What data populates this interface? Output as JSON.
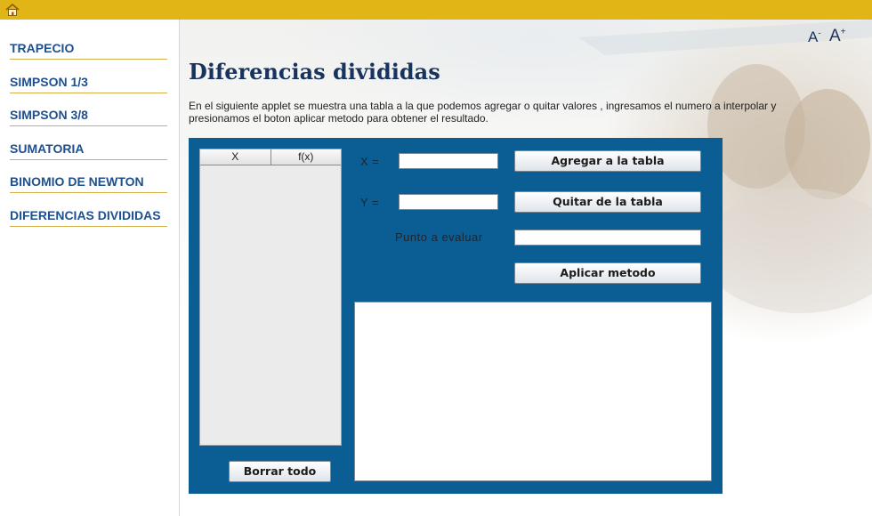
{
  "topbar": {
    "home_icon": "home-icon"
  },
  "sidebar": {
    "items": [
      {
        "label": "TRAPECIO"
      },
      {
        "label": "SIMPSON 1/3"
      },
      {
        "label": "SIMPSON 3/8"
      },
      {
        "label": "SUMATORIA"
      },
      {
        "label": "BINOMIO DE NEWTON"
      },
      {
        "label": "DIFERENCIAS DIVIDIDAS"
      }
    ]
  },
  "font_controls": {
    "decrease": "A",
    "decrease_sup": "-",
    "increase": "A",
    "increase_sup": "+"
  },
  "page": {
    "title": "Diferencias divididas",
    "description": "En el siguiente applet se muestra una tabla a la que podemos agregar o quitar valores , ingresamos el numero a interpolar y presionamos el boton aplicar metodo para obtener el resultado."
  },
  "applet": {
    "table": {
      "columns": [
        "X",
        "f(x)"
      ],
      "rows": []
    },
    "x_label": "X  =",
    "x_value": "",
    "y_label": "Y  =",
    "y_value": "",
    "point_label": "Punto a evaluar",
    "point_value": "",
    "add_button": "Agregar a la tabla",
    "remove_button": "Quitar de la tabla",
    "apply_button": "Aplicar metodo",
    "clear_button": "Borrar todo",
    "output": ""
  },
  "colors": {
    "topbar": "#e2b516",
    "nav_text": "#1e4f8f",
    "applet_bg": "#0b5e93",
    "title": "#17345f"
  }
}
